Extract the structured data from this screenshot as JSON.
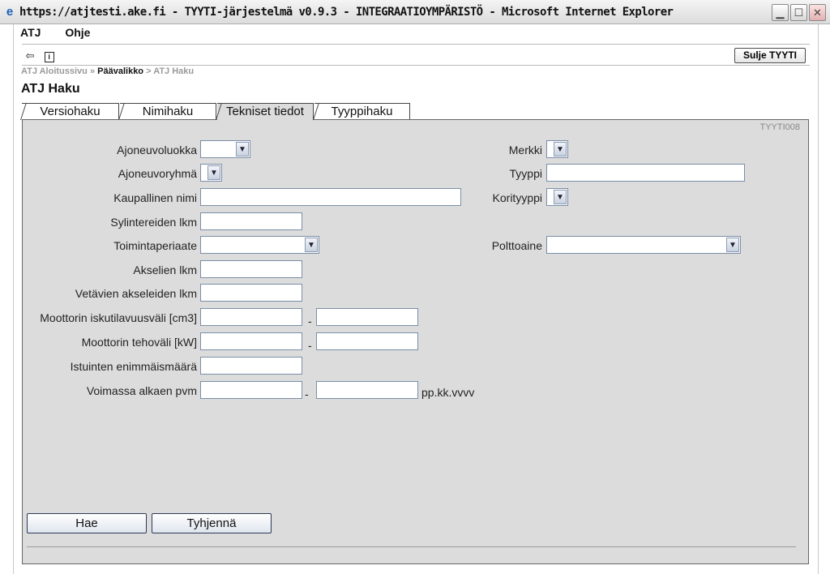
{
  "window": {
    "title": "https://atjtesti.ake.fi - TYYTI-järjestelmä v0.9.3 - INTEGRAATIOYMPÄRISTÖ - Microsoft Internet Explorer",
    "min_icon": "minimize-icon",
    "max_icon": "maximize-icon",
    "close_icon": "close-icon"
  },
  "menu": {
    "items": [
      "ATJ",
      "Ohje"
    ]
  },
  "toolbar": {
    "close_label": "Sulje TYYTI",
    "back_icon": "back-arrow-icon",
    "info_icon": "info-icon"
  },
  "breadcrumb": {
    "item1": "ATJ Aloitussivu",
    "sep1": "»",
    "item2": "Päävalikko",
    "sep2": ">",
    "item3": "ATJ Haku"
  },
  "page": {
    "title": "ATJ Haku",
    "code": "TYYTI008"
  },
  "tabs": [
    {
      "label": "Versiohaku",
      "active": false
    },
    {
      "label": "Nimihaku",
      "active": false
    },
    {
      "label": "Tekniset tiedot",
      "active": true
    },
    {
      "label": "Tyyppihaku",
      "active": false
    }
  ],
  "form": {
    "ajoneuvoluokka": {
      "label": "Ajoneuvoluokka",
      "value": ""
    },
    "ajoneuvoryhma": {
      "label": "Ajoneuvoryhmä",
      "value": ""
    },
    "kaupallinen_nimi": {
      "label": "Kaupallinen nimi",
      "value": ""
    },
    "sylinterit": {
      "label": "Sylintereiden lkm",
      "value": ""
    },
    "toimintaperiaate": {
      "label": "Toimintaperiaate",
      "value": ""
    },
    "akselit": {
      "label": "Akselien lkm",
      "value": ""
    },
    "vetavat_akselit": {
      "label": "Vetävien akseleiden lkm",
      "value": ""
    },
    "iskutilavuus": {
      "label": "Moottorin iskutilavuusväli [cm3]",
      "from": "",
      "to": "",
      "sep": "-"
    },
    "teho": {
      "label": "Moottorin tehoväli [kW]",
      "from": "",
      "to": "",
      "sep": "-"
    },
    "istuimet": {
      "label": "Istuinten enimmäismäärä",
      "value": ""
    },
    "voimassa": {
      "label": "Voimassa alkaen pvm",
      "from": "",
      "to": "",
      "sep": "-",
      "format": "pp.kk.vvvv"
    },
    "merkki": {
      "label": "Merkki",
      "value": ""
    },
    "tyyppi": {
      "label": "Tyyppi",
      "value": ""
    },
    "korityyppi": {
      "label": "Korityyppi",
      "value": ""
    },
    "polttoaine": {
      "label": "Polttoaine",
      "value": ""
    }
  },
  "buttons": {
    "search": "Hae",
    "clear": "Tyhjennä"
  }
}
